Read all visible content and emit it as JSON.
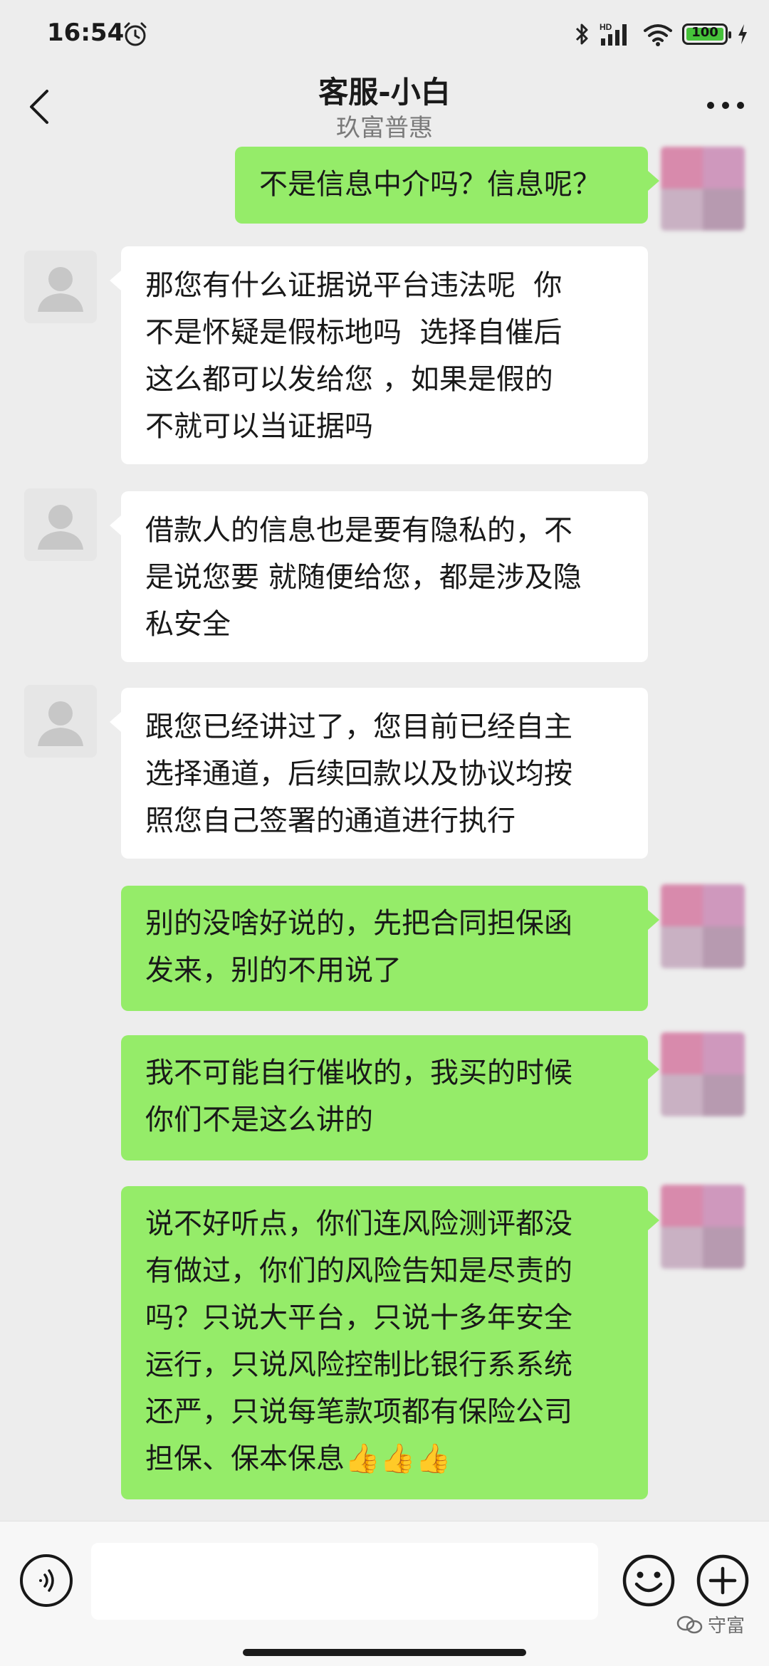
{
  "status_bar": {
    "time": "16:54",
    "network": "HD",
    "battery": "100"
  },
  "nav": {
    "title": "客服-小白",
    "subtitle": "玖富普惠",
    "back_icon": "chevron-left-icon",
    "more_icon": "more-dots-icon"
  },
  "messages": [
    {
      "side": "out",
      "text": "不是信息中介吗？信息呢？"
    },
    {
      "side": "in",
      "text": "那您有什么证据说平台违法呢  你\n不是怀疑是假标地吗  选择自催后\n这么都可以发给您 ，如果是假的\n不就可以当证据吗"
    },
    {
      "side": "in",
      "text": "借款人的信息也是要有隐私的，不\n是说您要 就随便给您，都是涉及隐\n私安全"
    },
    {
      "side": "in",
      "text": "跟您已经讲过了，您目前已经自主\n选择通道，后续回款以及协议均按\n照您自己签署的通道进行执行"
    },
    {
      "side": "out",
      "text": "别的没啥好说的，先把合同担保函\n发来，别的不用说了"
    },
    {
      "side": "out",
      "text": "我不可能自行催收的，我买的时候\n你们不是这么讲的"
    },
    {
      "side": "out",
      "text": "说不好听点，你们连风险测评都没\n有做过，你们的风险告知是尽责的\n吗？只说大平台，只说十多年安全\n运行，只说风险控制比银行系系统\n还严，只说每笔款项都有保险公司\n担保、保本保息👍👍👍"
    }
  ],
  "input_bar": {
    "placeholder": "",
    "voice_icon": "voice-icon",
    "emoji_icon": "emoji-icon",
    "plus_icon": "plus-icon"
  },
  "watermark": "守富",
  "colors": {
    "background": "#ededed",
    "outgoing_bubble": "#95ec69",
    "incoming_bubble": "#ffffff",
    "battery_fill": "#46c23a"
  }
}
